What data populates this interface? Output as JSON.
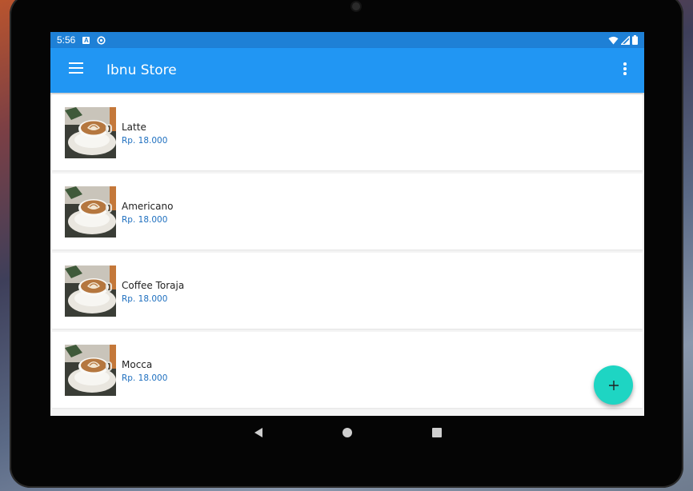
{
  "status_bar": {
    "time": "5:56",
    "notification_icons": [
      "a-icon",
      "sync-icon"
    ],
    "system_icons": [
      "wifi-icon",
      "signal-icon",
      "battery-icon"
    ]
  },
  "app_bar": {
    "title": "Ibnu Store",
    "menu_icon": "hamburger-menu-icon",
    "overflow_icon": "more-vert-icon"
  },
  "products": [
    {
      "name": "Latte",
      "price": "Rp. 18.000"
    },
    {
      "name": "Americano",
      "price": "Rp. 18.000"
    },
    {
      "name": "Coffee Toraja",
      "price": "Rp. 18.000"
    },
    {
      "name": "Mocca",
      "price": "Rp. 18.000"
    }
  ],
  "fab": {
    "icon": "plus-icon",
    "color": "#1ed5c3"
  },
  "navigation_bar": [
    "back-icon",
    "home-icon",
    "recents-icon"
  ],
  "colors": {
    "app_bar": "#2196f3",
    "status_bar": "#1e80d6",
    "price_text": "#1e6fbf"
  }
}
